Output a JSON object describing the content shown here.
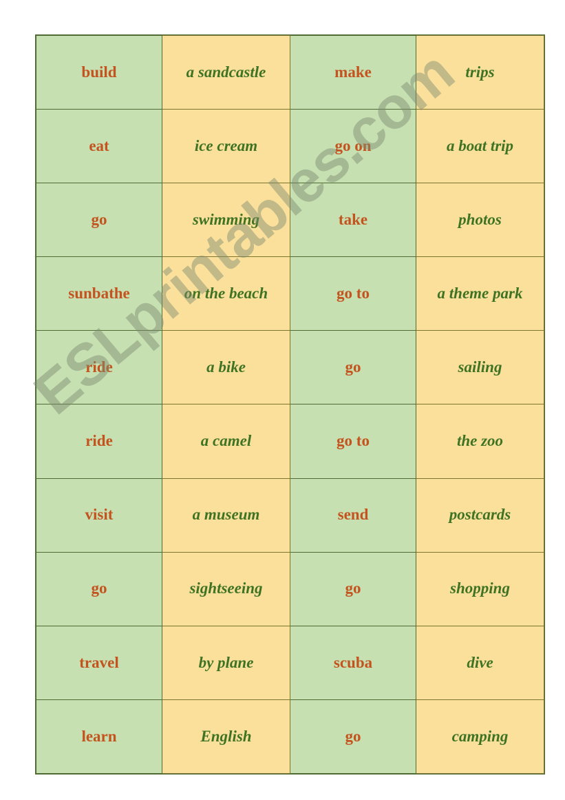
{
  "document": {
    "type": "esl-worksheet-domino-cards",
    "topic": "Holiday activity collocations",
    "page_background": "#ffffff"
  },
  "watermark": {
    "text": "ESLprintables.com",
    "color": "#7d8a70",
    "rotation_deg": -40,
    "opacity": 0.45
  },
  "colors": {
    "verb_cell_background": "#c6e0b1",
    "phrase_cell_background": "#fbe09b",
    "verb_text": "#c4541f",
    "phrase_text": "#3f7324",
    "border_green": "#4f6b33",
    "border_olive": "#7c7530"
  },
  "table": {
    "columns": 4,
    "rows": 10,
    "column_types": [
      "verb",
      "phrase",
      "verb",
      "phrase"
    ],
    "cells": [
      [
        {
          "text": "build",
          "type": "verb"
        },
        {
          "text": "a sandcastle",
          "type": "phrase"
        },
        {
          "text": "make",
          "type": "verb"
        },
        {
          "text": "trips",
          "type": "phrase"
        }
      ],
      [
        {
          "text": "eat",
          "type": "verb"
        },
        {
          "text": "ice cream",
          "type": "phrase"
        },
        {
          "text": "go on",
          "type": "verb"
        },
        {
          "text": "a boat trip",
          "type": "phrase"
        }
      ],
      [
        {
          "text": "go",
          "type": "verb"
        },
        {
          "text": "swimming",
          "type": "phrase"
        },
        {
          "text": "take",
          "type": "verb"
        },
        {
          "text": "photos",
          "type": "phrase"
        }
      ],
      [
        {
          "text": "sunbathe",
          "type": "verb"
        },
        {
          "text": "on the beach",
          "type": "phrase"
        },
        {
          "text": "go to",
          "type": "verb"
        },
        {
          "text": "a theme park",
          "type": "phrase"
        }
      ],
      [
        {
          "text": "ride",
          "type": "verb"
        },
        {
          "text": "a bike",
          "type": "phrase"
        },
        {
          "text": "go",
          "type": "verb"
        },
        {
          "text": "sailing",
          "type": "phrase"
        }
      ],
      [
        {
          "text": "ride",
          "type": "verb"
        },
        {
          "text": "a camel",
          "type": "phrase"
        },
        {
          "text": "go to",
          "type": "verb"
        },
        {
          "text": "the zoo",
          "type": "phrase"
        }
      ],
      [
        {
          "text": "visit",
          "type": "verb"
        },
        {
          "text": "a museum",
          "type": "phrase"
        },
        {
          "text": "send",
          "type": "verb"
        },
        {
          "text": "postcards",
          "type": "phrase"
        }
      ],
      [
        {
          "text": "go",
          "type": "verb"
        },
        {
          "text": "sightseeing",
          "type": "phrase"
        },
        {
          "text": "go",
          "type": "verb"
        },
        {
          "text": "shopping",
          "type": "phrase"
        }
      ],
      [
        {
          "text": "travel",
          "type": "verb"
        },
        {
          "text": "by plane",
          "type": "phrase"
        },
        {
          "text": "scuba",
          "type": "verb"
        },
        {
          "text": "dive",
          "type": "phrase"
        }
      ],
      [
        {
          "text": "learn",
          "type": "verb"
        },
        {
          "text": "English",
          "type": "phrase"
        },
        {
          "text": "go",
          "type": "verb"
        },
        {
          "text": "camping",
          "type": "phrase"
        }
      ]
    ]
  }
}
